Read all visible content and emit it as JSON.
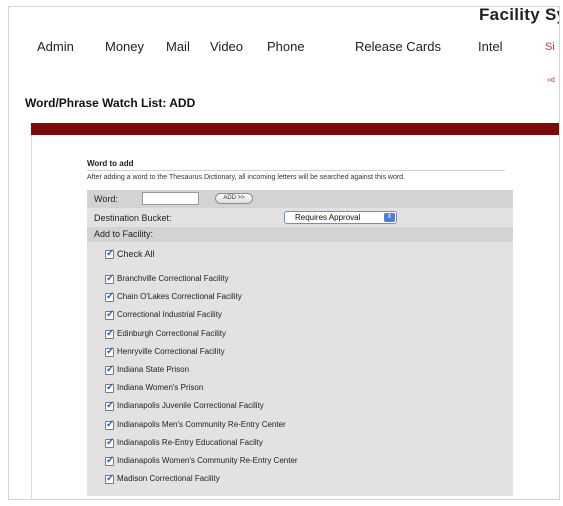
{
  "header": {
    "brand": "Facility Sys",
    "nav": [
      "Admin",
      "Money",
      "Mail",
      "Video",
      "Phone",
      "Release Cards",
      "Intel",
      "Si"
    ],
    "tiny_link": "«d"
  },
  "page": {
    "title": "Word/Phrase Watch List: ADD"
  },
  "form": {
    "section_title": "Word to add",
    "description": "After adding a word to the Thesaurus Dictionary, all incoming letters will be searched against this word.",
    "word_label": "Word:",
    "word_value": "",
    "add_button": "ADD >>",
    "bucket_label": "Destination Bucket:",
    "bucket_selected": "Requires Approval",
    "add_to_facility_label": "Add to Facility:",
    "check_all_label": "Check All",
    "check_all_checked": true,
    "facilities": [
      {
        "label": "Branchville Correctional Facility",
        "checked": true
      },
      {
        "label": "Chain O'Lakes Correctional Facility",
        "checked": true
      },
      {
        "label": "Correctional Industrial Facility",
        "checked": true
      },
      {
        "label": "Edinburgh Correctional Facility",
        "checked": true
      },
      {
        "label": "Henryville Correctional Facility",
        "checked": true
      },
      {
        "label": "Indiana State Prison",
        "checked": true
      },
      {
        "label": "Indiana Women's Prison",
        "checked": true
      },
      {
        "label": "Indianapolis Juvenile Correctional Facility",
        "checked": true
      },
      {
        "label": "Indianapolis Men's Community Re-Entry Center",
        "checked": true
      },
      {
        "label": "Indianapolis Re-Entry Educational Facilty",
        "checked": true
      },
      {
        "label": "Indianapolis Women's Community Re-Entry Center",
        "checked": true
      },
      {
        "label": "Madison Correctional Facility",
        "checked": true
      }
    ]
  },
  "colors": {
    "banner": "#7d0a0a",
    "check": "#2a5fb8",
    "select_accent": "#4a7fd4"
  }
}
